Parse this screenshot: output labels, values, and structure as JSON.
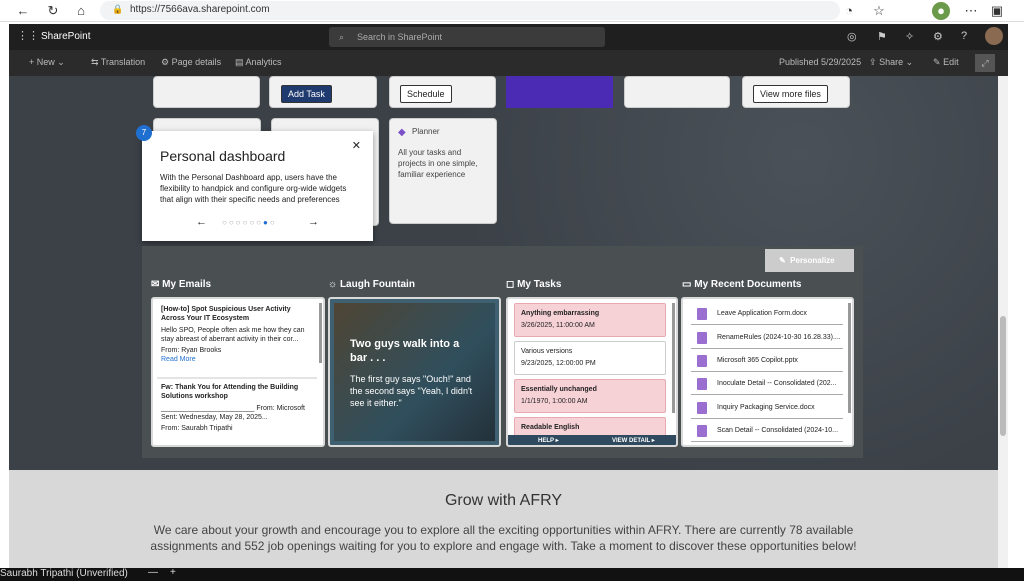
{
  "browser": {
    "url": "https://7566ava.sharepoint.com"
  },
  "sharepoint": {
    "app_name": "SharePoint",
    "search_placeholder": "Search in SharePoint"
  },
  "command_bar": {
    "new": "New",
    "translation": "Translation",
    "page_details": "Page details",
    "analytics": "Analytics",
    "published": "Published 5/29/2025",
    "share": "Share",
    "edit": "Edit"
  },
  "tiles": {
    "add_task": "Add Task",
    "schedule": "Schedule",
    "view_more_files": "View more files",
    "planner_title": "Planner",
    "planner_desc": "All your tasks and projects in one simple, familiar experience"
  },
  "popup": {
    "step": "7",
    "title": "Personal dashboard",
    "text": "With the Personal Dashboard app, users have the flexibility to handpick and configure org-wide widgets that align with their specific needs and preferences"
  },
  "dashboard": {
    "personalize": "Personalize",
    "emails_title": "My Emails",
    "laugh_title": "Laugh Fountain",
    "tasks_title": "My Tasks",
    "docs_title": "My Recent Documents",
    "emails": [
      {
        "subject": "[How-to] Spot Suspicious User Activity Across Your IT Ecosystem",
        "body": "Hello SPO, People often ask me how they can stay abreast of aberrant activity in their cor...",
        "from": "From: Ryan Brooks",
        "read_more": "Read More"
      },
      {
        "subject": "Fw: Thank You for Attending the Building Solutions workshop",
        "body": "________________________ From: Microsoft Sent: Wednesday, May 28, 2025...",
        "from": "From: Saurabh Tripathi"
      }
    ],
    "joke": {
      "title": "Two guys walk into a bar . . .",
      "text": "The first guy says \"Ouch!\" and the second says \"Yeah, I didn't see it either.\""
    },
    "tasks": [
      {
        "title": "Anything embarrassing",
        "date": "3/26/2025, 11:00:00 AM"
      },
      {
        "title": "Various versions",
        "date": "9/23/2025, 12:00:00 PM"
      },
      {
        "title": "Essentially unchanged",
        "date": "1/1/1970, 1:00:00 AM"
      },
      {
        "title": "Readable English",
        "date": ""
      }
    ],
    "task_help": "HELP",
    "task_view": "VIEW DETAIL",
    "docs": [
      "Leave Application Form.docx",
      "RenameRules (2024-10-30 16.28.33)....",
      "Microsoft 365 Copilot.pptx",
      "Inoculate Detail -- Consolidated (202...",
      "Inquiry Packaging Service.docx",
      "Scan Detail -- Consolidated (2024-10..."
    ]
  },
  "grow": {
    "title": "Grow with AFRY",
    "text": "We care about your growth and encourage you to explore all the exciting opportunities within AFRY. There are currently 78 available assignments and 552 job openings waiting for you to explore and engage with. Take a moment to discover these opportunities below!"
  },
  "taskbar": {
    "user": "Saurabh Tripathi (Unverified)"
  }
}
